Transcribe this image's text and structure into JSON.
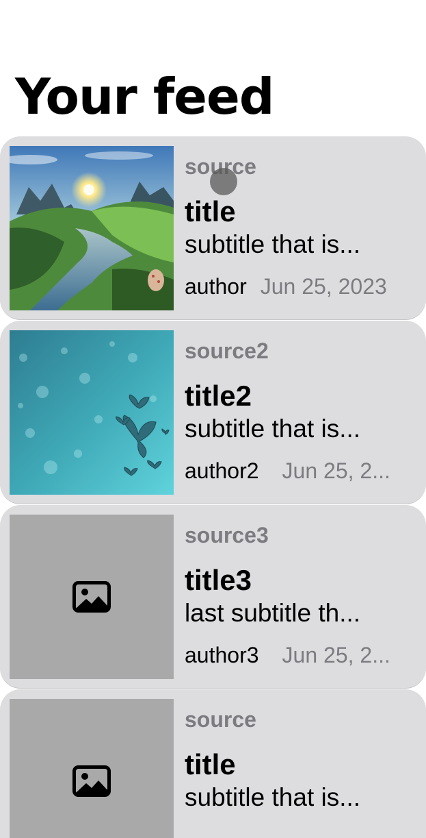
{
  "page": {
    "title": "Your feed"
  },
  "feed": {
    "items": [
      {
        "source": "source",
        "title": "title",
        "subtitle": "subtitle that is...",
        "author": "author",
        "date": "Jun 25, 2023",
        "thumbnail": "landscape-river-image"
      },
      {
        "source": "source2",
        "title": "title2",
        "subtitle": "subtitle that is...",
        "author": "author2",
        "date": "Jun 25, 2...",
        "thumbnail": "butterflies-teal-image"
      },
      {
        "source": "source3",
        "title": "title3",
        "subtitle": "last subtitle th...",
        "author": "author3",
        "date": "Jun 25, 2...",
        "thumbnail": "photo-placeholder-icon"
      },
      {
        "source": "source",
        "title": "title",
        "subtitle": "subtitle that is...",
        "thumbnail": "photo-placeholder-icon"
      }
    ]
  },
  "colors": {
    "card_background": "#dddde0",
    "secondary_text": "#7c7c80",
    "placeholder_background": "#a9a9a9"
  }
}
